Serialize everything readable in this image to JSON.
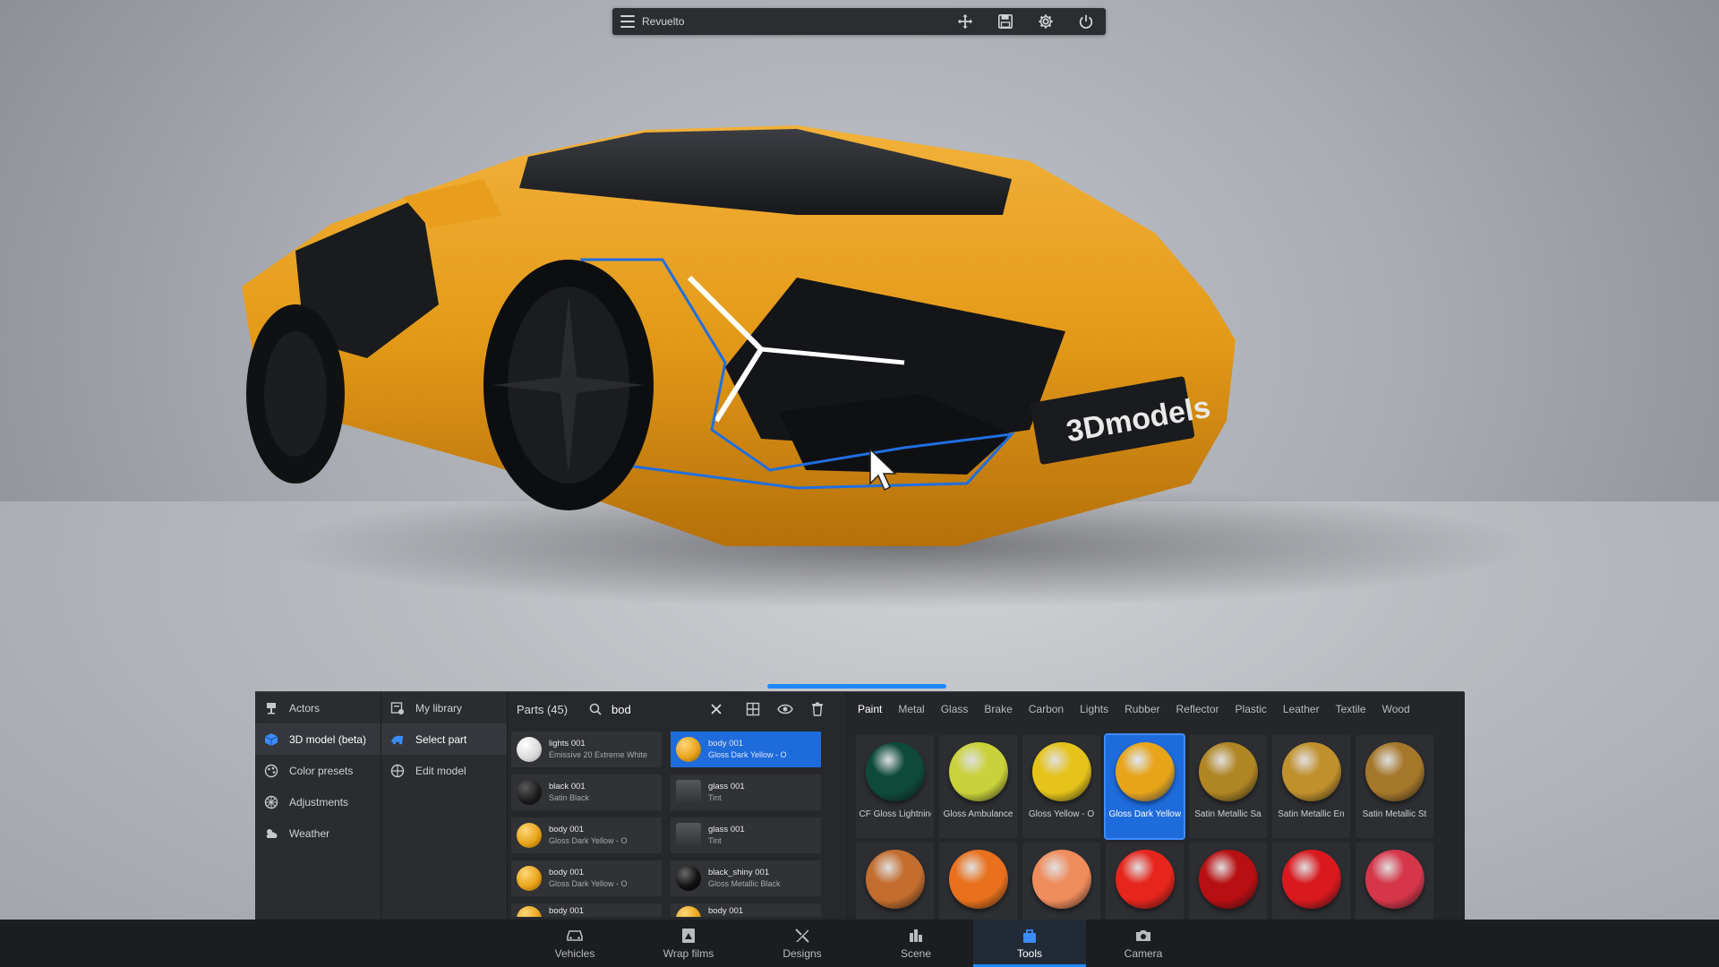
{
  "window": {
    "title": "Revuelto"
  },
  "watermark": {
    "text": "3Dmodels"
  },
  "nav": {
    "items": [
      {
        "label": "Actors",
        "icon": "actors-icon"
      },
      {
        "label": "3D model (beta)",
        "icon": "cube-icon",
        "active": true
      },
      {
        "label": "Color presets",
        "icon": "color-presets-icon"
      },
      {
        "label": "Adjustments",
        "icon": "adjustments-icon"
      },
      {
        "label": "Weather",
        "icon": "weather-icon"
      }
    ]
  },
  "subnav": {
    "items": [
      {
        "label": "My library",
        "icon": "library-icon"
      },
      {
        "label": "Select part",
        "icon": "select-part-icon",
        "active": true
      },
      {
        "label": "Edit model",
        "icon": "edit-model-icon"
      }
    ]
  },
  "parts": {
    "title": "Parts (45)",
    "search_value": "bod",
    "items": [
      {
        "name": "lights 001",
        "material": "Emissive 20 Extreme White",
        "color": "#f4f4f4"
      },
      {
        "name": "body 001",
        "material": "Gloss Dark Yellow - O",
        "color": "#e8a419",
        "selected": true
      },
      {
        "name": "black 001",
        "material": "Satin Black",
        "color": "#1a1a1a"
      },
      {
        "name": "glass 001",
        "material": "Tint",
        "color": "#3a3d40"
      },
      {
        "name": "body 001",
        "material": "Gloss Dark Yellow - O",
        "color": "#e8a419"
      },
      {
        "name": "glass 001",
        "material": "Tint",
        "color": "#3a3d40"
      },
      {
        "name": "body 001",
        "material": "Gloss Dark Yellow - O",
        "color": "#e8a419"
      },
      {
        "name": "black_shiny 001",
        "material": "Gloss Metallic Black",
        "color": "#111111"
      },
      {
        "name": "body 001",
        "material": "",
        "color": "#e8a419"
      },
      {
        "name": "body 001",
        "material": "",
        "color": "#e8a419"
      }
    ]
  },
  "materials": {
    "tabs": [
      "Paint",
      "Metal",
      "Glass",
      "Brake",
      "Carbon",
      "Lights",
      "Rubber",
      "Reflector",
      "Plastic",
      "Leather",
      "Textile",
      "Wood"
    ],
    "active_tab": "Paint",
    "swatches": [
      {
        "label": "CF Gloss Lightning",
        "color": "#0d4a3a"
      },
      {
        "label": "Gloss Ambulance",
        "color": "#c9d23a"
      },
      {
        "label": "Gloss Yellow - O",
        "color": "#e5c31a"
      },
      {
        "label": "Gloss Dark Yellow",
        "color": "#e8a419",
        "selected": true
      },
      {
        "label": "Satin Metallic Sa",
        "color": "#b08524"
      },
      {
        "label": "Satin Metallic En",
        "color": "#c0902c"
      },
      {
        "label": "Satin Metallic St",
        "color": "#a5772a"
      },
      {
        "label": "",
        "color": "#c36d2e"
      },
      {
        "label": "",
        "color": "#e9711d"
      },
      {
        "label": "",
        "color": "#ef8c5c"
      },
      {
        "label": "",
        "color": "#e6251c"
      },
      {
        "label": "",
        "color": "#b80f12"
      },
      {
        "label": "",
        "color": "#d8191e"
      },
      {
        "label": "",
        "color": "#d6364a"
      }
    ]
  },
  "dock": {
    "items": [
      {
        "label": "Vehicles",
        "icon": "car-icon"
      },
      {
        "label": "Wrap films",
        "icon": "wrap-films-icon"
      },
      {
        "label": "Designs",
        "icon": "designs-icon"
      },
      {
        "label": "Scene",
        "icon": "scene-icon"
      },
      {
        "label": "Tools",
        "icon": "tools-icon",
        "active": true
      },
      {
        "label": "Camera",
        "icon": "camera-icon"
      }
    ]
  },
  "colors": {
    "accent": "#1e88ff",
    "body_paint": "#e8a419",
    "panel_bg": "#26282c"
  }
}
